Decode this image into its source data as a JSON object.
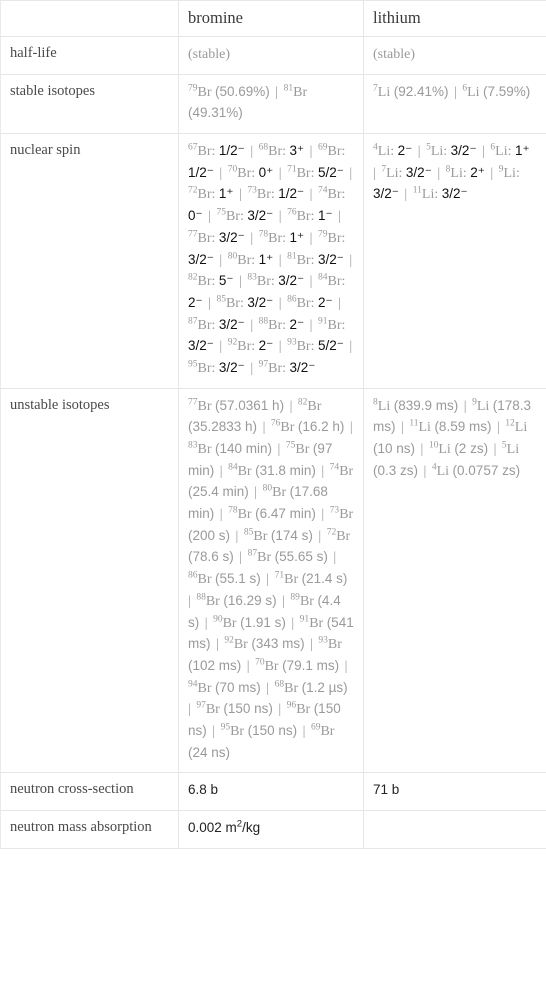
{
  "table": {
    "corner_label": "",
    "columns": [
      "bromine",
      "lithium"
    ],
    "row_labels": [
      "half-life",
      "stable isotopes",
      "nuclear spin",
      "unstable isotopes",
      "neutron cross-section",
      "neutron mass absorption"
    ],
    "half_life": {
      "bromine": "(stable)",
      "lithium": "(stable)"
    },
    "stable_isotopes": {
      "bromine": [
        {
          "mass": "79",
          "symbol": "Br",
          "value": "(50.69%)"
        },
        {
          "mass": "81",
          "symbol": "Br",
          "value": "(49.31%)"
        }
      ],
      "lithium": [
        {
          "mass": "7",
          "symbol": "Li",
          "value": "(92.41%)"
        },
        {
          "mass": "6",
          "symbol": "Li",
          "value": "(7.59%)"
        }
      ]
    },
    "nuclear_spin": {
      "bromine": [
        {
          "mass": "67",
          "symbol": "Br",
          "value": "1/2⁻"
        },
        {
          "mass": "68",
          "symbol": "Br",
          "value": "3⁺"
        },
        {
          "mass": "69",
          "symbol": "Br",
          "value": "1/2⁻"
        },
        {
          "mass": "70",
          "symbol": "Br",
          "value": "0⁺"
        },
        {
          "mass": "71",
          "symbol": "Br",
          "value": "5/2⁻"
        },
        {
          "mass": "72",
          "symbol": "Br",
          "value": "1⁺"
        },
        {
          "mass": "73",
          "symbol": "Br",
          "value": "1/2⁻"
        },
        {
          "mass": "74",
          "symbol": "Br",
          "value": "0⁻"
        },
        {
          "mass": "75",
          "symbol": "Br",
          "value": "3/2⁻"
        },
        {
          "mass": "76",
          "symbol": "Br",
          "value": "1⁻"
        },
        {
          "mass": "77",
          "symbol": "Br",
          "value": "3/2⁻"
        },
        {
          "mass": "78",
          "symbol": "Br",
          "value": "1⁺"
        },
        {
          "mass": "79",
          "symbol": "Br",
          "value": "3/2⁻"
        },
        {
          "mass": "80",
          "symbol": "Br",
          "value": "1⁺"
        },
        {
          "mass": "81",
          "symbol": "Br",
          "value": "3/2⁻"
        },
        {
          "mass": "82",
          "symbol": "Br",
          "value": "5⁻"
        },
        {
          "mass": "83",
          "symbol": "Br",
          "value": "3/2⁻"
        },
        {
          "mass": "84",
          "symbol": "Br",
          "value": "2⁻"
        },
        {
          "mass": "85",
          "symbol": "Br",
          "value": "3/2⁻"
        },
        {
          "mass": "86",
          "symbol": "Br",
          "value": "2⁻"
        },
        {
          "mass": "87",
          "symbol": "Br",
          "value": "3/2⁻"
        },
        {
          "mass": "88",
          "symbol": "Br",
          "value": "2⁻"
        },
        {
          "mass": "91",
          "symbol": "Br",
          "value": "3/2⁻"
        },
        {
          "mass": "92",
          "symbol": "Br",
          "value": "2⁻"
        },
        {
          "mass": "93",
          "symbol": "Br",
          "value": "5/2⁻"
        },
        {
          "mass": "95",
          "symbol": "Br",
          "value": "3/2⁻"
        },
        {
          "mass": "97",
          "symbol": "Br",
          "value": "3/2⁻"
        }
      ],
      "lithium": [
        {
          "mass": "4",
          "symbol": "Li",
          "value": "2⁻"
        },
        {
          "mass": "5",
          "symbol": "Li",
          "value": "3/2⁻"
        },
        {
          "mass": "6",
          "symbol": "Li",
          "value": "1⁺"
        },
        {
          "mass": "7",
          "symbol": "Li",
          "value": "3/2⁻"
        },
        {
          "mass": "8",
          "symbol": "Li",
          "value": "2⁺"
        },
        {
          "mass": "9",
          "symbol": "Li",
          "value": "3/2⁻"
        },
        {
          "mass": "11",
          "symbol": "Li",
          "value": "3/2⁻"
        }
      ]
    },
    "unstable_isotopes": {
      "bromine": [
        {
          "mass": "77",
          "symbol": "Br",
          "value": "(57.0361 h)"
        },
        {
          "mass": "82",
          "symbol": "Br",
          "value": "(35.2833 h)"
        },
        {
          "mass": "76",
          "symbol": "Br",
          "value": "(16.2 h)"
        },
        {
          "mass": "83",
          "symbol": "Br",
          "value": "(140 min)"
        },
        {
          "mass": "75",
          "symbol": "Br",
          "value": "(97 min)"
        },
        {
          "mass": "84",
          "symbol": "Br",
          "value": "(31.8 min)"
        },
        {
          "mass": "74",
          "symbol": "Br",
          "value": "(25.4 min)"
        },
        {
          "mass": "80",
          "symbol": "Br",
          "value": "(17.68 min)"
        },
        {
          "mass": "78",
          "symbol": "Br",
          "value": "(6.47 min)"
        },
        {
          "mass": "73",
          "symbol": "Br",
          "value": "(200 s)"
        },
        {
          "mass": "85",
          "symbol": "Br",
          "value": "(174 s)"
        },
        {
          "mass": "72",
          "symbol": "Br",
          "value": "(78.6 s)"
        },
        {
          "mass": "87",
          "symbol": "Br",
          "value": "(55.65 s)"
        },
        {
          "mass": "86",
          "symbol": "Br",
          "value": "(55.1 s)"
        },
        {
          "mass": "71",
          "symbol": "Br",
          "value": "(21.4 s)"
        },
        {
          "mass": "88",
          "symbol": "Br",
          "value": "(16.29 s)"
        },
        {
          "mass": "89",
          "symbol": "Br",
          "value": "(4.4 s)"
        },
        {
          "mass": "90",
          "symbol": "Br",
          "value": "(1.91 s)"
        },
        {
          "mass": "91",
          "symbol": "Br",
          "value": "(541 ms)"
        },
        {
          "mass": "92",
          "symbol": "Br",
          "value": "(343 ms)"
        },
        {
          "mass": "93",
          "symbol": "Br",
          "value": "(102 ms)"
        },
        {
          "mass": "70",
          "symbol": "Br",
          "value": "(79.1 ms)"
        },
        {
          "mass": "94",
          "symbol": "Br",
          "value": "(70 ms)"
        },
        {
          "mass": "68",
          "symbol": "Br",
          "value": "(1.2 µs)"
        },
        {
          "mass": "97",
          "symbol": "Br",
          "value": "(150 ns)"
        },
        {
          "mass": "96",
          "symbol": "Br",
          "value": "(150 ns)"
        },
        {
          "mass": "95",
          "symbol": "Br",
          "value": "(150 ns)"
        },
        {
          "mass": "69",
          "symbol": "Br",
          "value": "(24 ns)"
        }
      ],
      "lithium": [
        {
          "mass": "8",
          "symbol": "Li",
          "value": "(839.9 ms)"
        },
        {
          "mass": "9",
          "symbol": "Li",
          "value": "(178.3 ms)"
        },
        {
          "mass": "11",
          "symbol": "Li",
          "value": "(8.59 ms)"
        },
        {
          "mass": "12",
          "symbol": "Li",
          "value": "(10 ns)"
        },
        {
          "mass": "10",
          "symbol": "Li",
          "value": "(2 zs)"
        },
        {
          "mass": "5",
          "symbol": "Li",
          "value": "(0.3 zs)"
        },
        {
          "mass": "4",
          "symbol": "Li",
          "value": "(0.0757 zs)"
        }
      ]
    },
    "neutron_cross_section": {
      "bromine": "6.8 b",
      "lithium": "71 b"
    },
    "neutron_mass_absorption": {
      "bromine_value": "0.002 m",
      "bromine_exp": "2",
      "bromine_unit": "/kg",
      "lithium": ""
    },
    "separator": "|"
  },
  "colors": {
    "border": "#e6e6e6",
    "label_text": "#4a4a4a",
    "value_text": "#222222",
    "dim_text": "#9a9a9a",
    "background": "#ffffff"
  }
}
